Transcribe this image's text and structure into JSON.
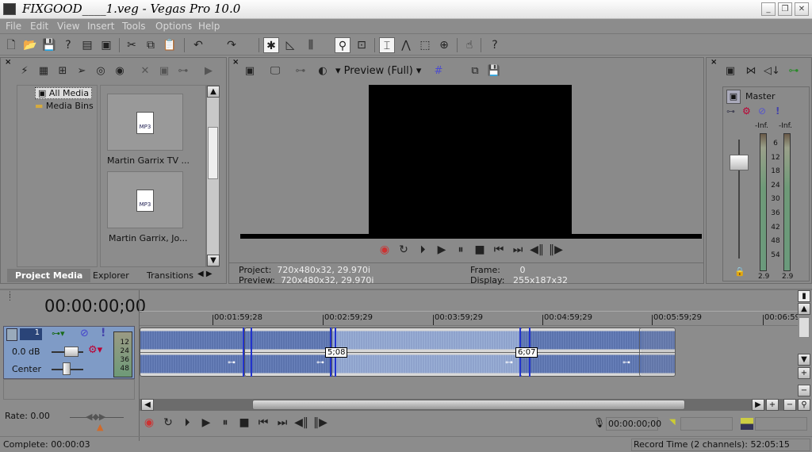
{
  "window": {
    "title": "FIXGOOD____1.veg - Vegas Pro 10.0",
    "min": "_",
    "restore": "❐",
    "close": "✕"
  },
  "menu": [
    "File",
    "Edit",
    "View",
    "Insert",
    "Tools",
    "Options",
    "Help"
  ],
  "explorer": {
    "tree": [
      "All Media",
      "Media Bins"
    ],
    "items": [
      "Martin Garrix  TV ...",
      "Martin Garrix, Jo..."
    ],
    "mp3": "MP3",
    "tabs": [
      "Project Media",
      "Explorer",
      "Transitions"
    ]
  },
  "preview": {
    "quality": "Preview (Full)",
    "project_label": "Project:",
    "project": "720x480x32, 29.970i",
    "preview_label": "Preview:",
    "preview": "720x480x32, 29.970i",
    "frame_label": "Frame:",
    "frame": "0",
    "display_label": "Display:",
    "display": "255x187x32"
  },
  "mixer": {
    "master": "Master",
    "peak_left": "-Inf.",
    "peak_right": "-Inf.",
    "scale": [
      "6",
      "12",
      "18",
      "24",
      "30",
      "36",
      "42",
      "48",
      "54"
    ],
    "level_left": "2.9",
    "level_right": "2.9"
  },
  "timeline": {
    "timecode": "00:00:00;00",
    "ruler": [
      "00:01:59;28",
      "00:02:59;29",
      "00:03:59;29",
      "00:04:59;29",
      "00:05:59;29",
      "00:06:59;"
    ],
    "track": {
      "number": "1",
      "volume": "0.0 dB",
      "pan": "Center",
      "meter": [
        "12",
        "24",
        "36",
        "48"
      ]
    },
    "crossfades": [
      "5;08",
      "6;07"
    ]
  },
  "transport": {
    "rate": "Rate: 0.00",
    "record_timecode": "00:00:00;00"
  },
  "status": {
    "complete": "Complete: 00:00:03",
    "record_time": "Record Time (2 channels): 52:05:15"
  }
}
